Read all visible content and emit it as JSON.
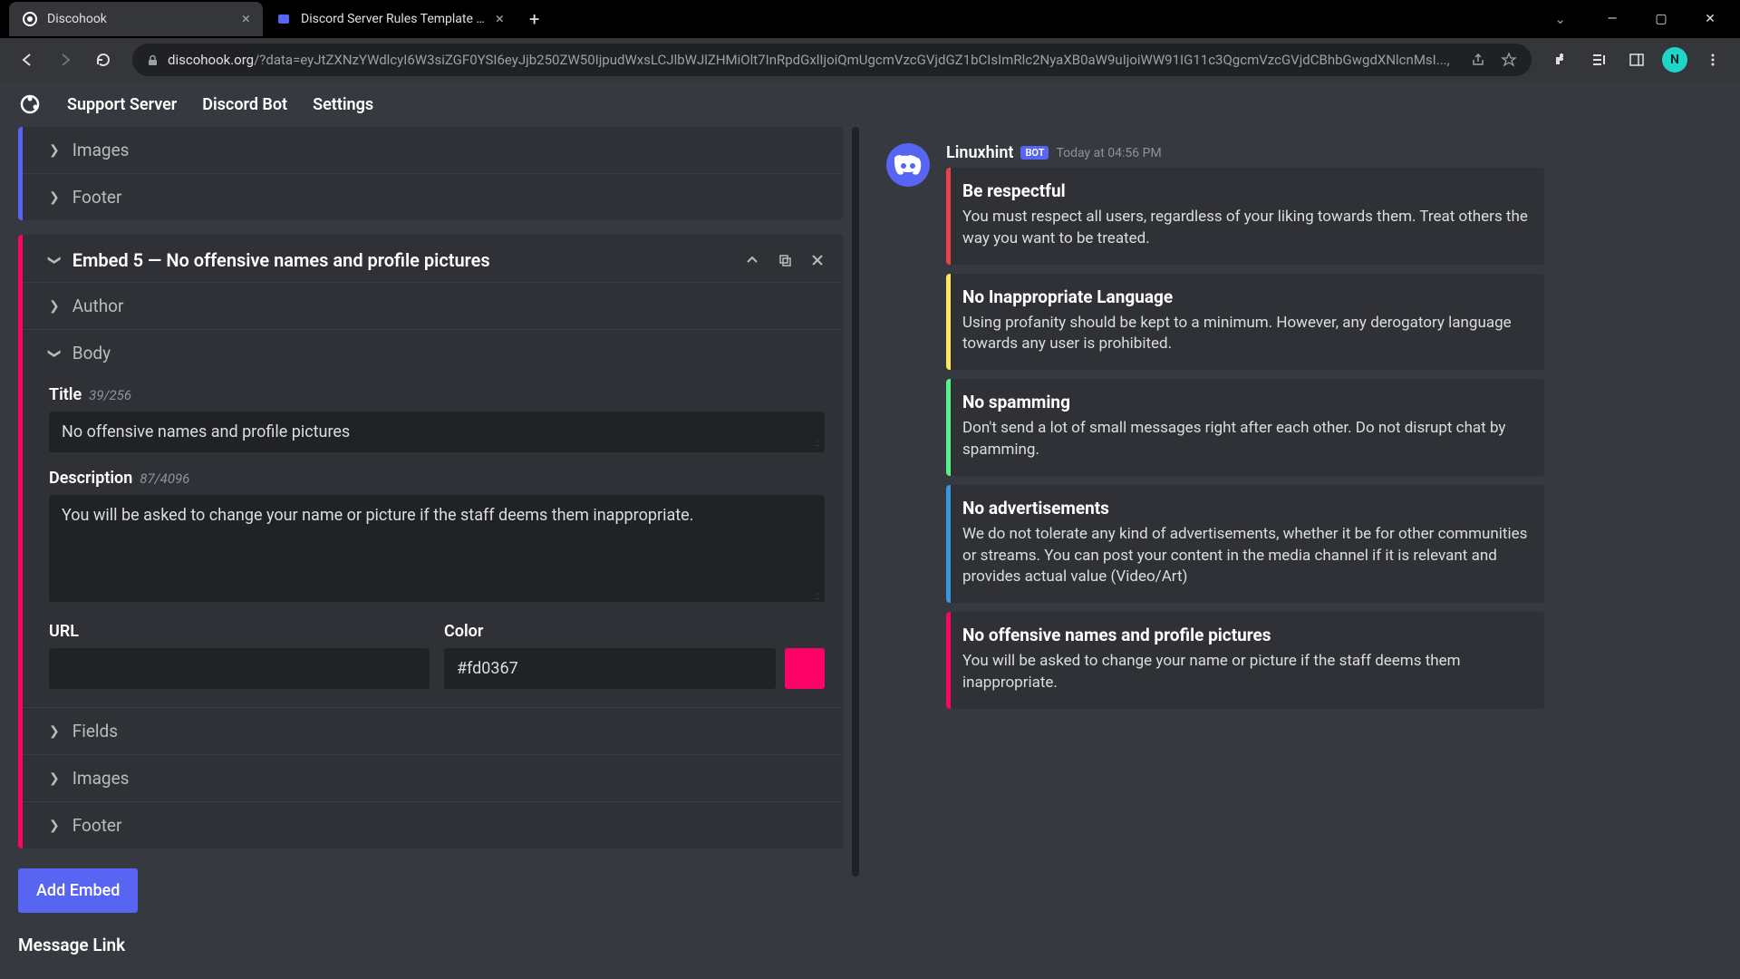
{
  "browser": {
    "tabs": [
      {
        "title": "Discohook",
        "active": true
      },
      {
        "title": "Discord Server Rules Template | D",
        "active": false
      }
    ],
    "url_domain": "discohook.org",
    "url_path": "/?data=eyJtZXNzYWdlcyI6W3siZGF0YSI6eyJjb250ZW50IjpudWxsLCJlbWJlZHMiOlt7InRpdGxlIjoiQmUgcmVzcGVjdGZ1bCIsImRlc2NyaXB0aW9uIjoiWW91IG11c3QgcmVzcGVjdCBhbGwgdXNlcnMsI...,",
    "avatar_letter": "N"
  },
  "header": {
    "nav": [
      "Support Server",
      "Discord Bot",
      "Settings"
    ]
  },
  "editor": {
    "prev_sections": [
      "Images",
      "Footer"
    ],
    "embed5": {
      "header": "Embed 5 — No offensive names and profile pictures",
      "author_label": "Author",
      "body_label": "Body",
      "title_label": "Title",
      "title_count": "39/256",
      "title_value": "No offensive names and profile pictures",
      "desc_label": "Description",
      "desc_count": "87/4096",
      "desc_value": "You will be asked to change your name or picture if the staff deems them inappropriate.",
      "url_label": "URL",
      "url_value": "",
      "color_label": "Color",
      "color_value": "#fd0367",
      "fields_label": "Fields",
      "images_label": "Images",
      "footer_label": "Footer"
    },
    "add_embed_btn": "Add Embed",
    "message_link_label": "Message Link"
  },
  "preview": {
    "username": "Linuxhint",
    "bot_badge": "BOT",
    "timestamp": "Today at 04:56 PM",
    "embeds": [
      {
        "color": "red",
        "title": "Be respectful",
        "desc": "You must respect all users, regardless of your liking towards them. Treat others the way you want to be treated."
      },
      {
        "color": "yellow",
        "title": "No Inappropriate Language",
        "desc": "Using profanity should be kept to a minimum. However, any derogatory language towards any user is prohibited."
      },
      {
        "color": "green",
        "title": "No spamming",
        "desc": "Don't send a lot of small messages right after each other. Do not disrupt chat by spamming."
      },
      {
        "color": "blue",
        "title": "No advertisements",
        "desc": "We do not tolerate any kind of advertisements, whether it be for other communities or streams. You can post your content in the media channel if it is relevant and provides actual value (Video/Art)"
      },
      {
        "color": "pink",
        "title": "No offensive names and profile pictures",
        "desc": "You will be asked to change your name or picture if the staff deems them inappropriate."
      }
    ]
  }
}
